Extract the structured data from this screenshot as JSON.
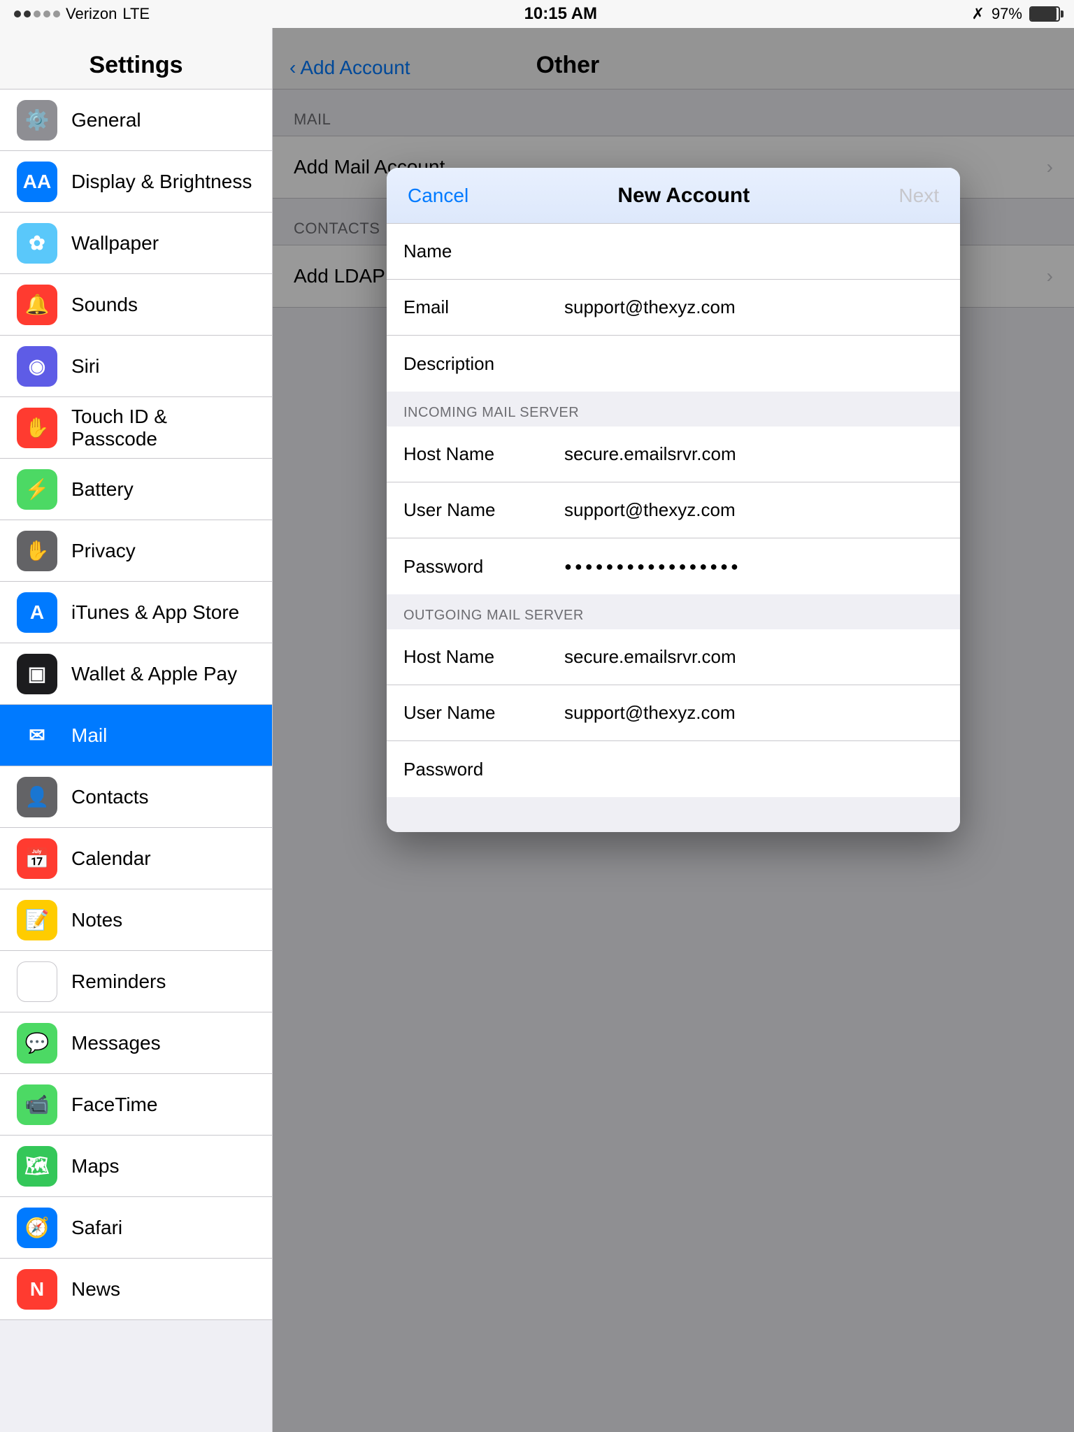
{
  "statusBar": {
    "carrier": "Verizon",
    "network": "LTE",
    "dots": [
      false,
      false,
      true,
      true,
      true
    ],
    "time": "10:15 AM",
    "bluetooth": "bluetooth",
    "battery_pct": "97%"
  },
  "sidebar": {
    "title": "Settings",
    "items": [
      {
        "id": "general",
        "label": "General",
        "icon": "⚙️",
        "iconClass": "icon-general",
        "active": false
      },
      {
        "id": "display",
        "label": "Display & Brightness",
        "icon": "AA",
        "iconClass": "icon-display",
        "active": false
      },
      {
        "id": "wallpaper",
        "label": "Wallpaper",
        "icon": "✿",
        "iconClass": "icon-wallpaper",
        "active": false
      },
      {
        "id": "sounds",
        "label": "Sounds",
        "icon": "🔔",
        "iconClass": "icon-sounds",
        "active": false
      },
      {
        "id": "siri",
        "label": "Siri",
        "icon": "◉",
        "iconClass": "icon-siri",
        "active": false
      },
      {
        "id": "touch",
        "label": "Touch ID & Passcode",
        "icon": "✋",
        "iconClass": "icon-touch",
        "active": false
      },
      {
        "id": "battery",
        "label": "Battery",
        "icon": "⚡",
        "iconClass": "icon-battery",
        "active": false
      },
      {
        "id": "privacy",
        "label": "Privacy",
        "icon": "✋",
        "iconClass": "icon-privacy",
        "active": false
      },
      {
        "id": "itunes",
        "label": "iTunes & App Store",
        "icon": "A",
        "iconClass": "icon-itunes",
        "active": false
      },
      {
        "id": "wallet",
        "label": "Wallet & Apple Pay",
        "icon": "▣",
        "iconClass": "icon-wallet",
        "active": false
      },
      {
        "id": "mail",
        "label": "Mail",
        "icon": "✉",
        "iconClass": "icon-mail",
        "active": true
      },
      {
        "id": "contacts",
        "label": "Contacts",
        "icon": "👤",
        "iconClass": "icon-contacts",
        "active": false
      },
      {
        "id": "calendar",
        "label": "Calendar",
        "icon": "📅",
        "iconClass": "icon-calendar",
        "active": false
      },
      {
        "id": "notes",
        "label": "Notes",
        "icon": "📝",
        "iconClass": "icon-notes",
        "active": false
      },
      {
        "id": "reminders",
        "label": "Reminders",
        "icon": "☰",
        "iconClass": "icon-reminders",
        "active": false
      },
      {
        "id": "messages",
        "label": "Messages",
        "icon": "💬",
        "iconClass": "icon-messages",
        "active": false
      },
      {
        "id": "facetime",
        "label": "FaceTime",
        "icon": "📹",
        "iconClass": "icon-facetime",
        "active": false
      },
      {
        "id": "maps",
        "label": "Maps",
        "icon": "🗺",
        "iconClass": "icon-maps",
        "active": false
      },
      {
        "id": "safari",
        "label": "Safari",
        "icon": "🧭",
        "iconClass": "icon-safari",
        "active": false
      },
      {
        "id": "news",
        "label": "News",
        "icon": "N",
        "iconClass": "icon-news",
        "active": false
      }
    ]
  },
  "rightPanel": {
    "backLabel": "Add Account",
    "title": "Other",
    "sections": [
      {
        "header": "MAIL",
        "items": [
          {
            "label": "Add Mail Account",
            "hasChevron": true
          }
        ]
      },
      {
        "header": "CONTACTS",
        "items": [
          {
            "label": "Add LDAP Account",
            "hasChevron": true
          }
        ]
      }
    ]
  },
  "modal": {
    "cancelLabel": "Cancel",
    "title": "New Account",
    "nextLabel": "Next",
    "fields": [
      {
        "label": "Name",
        "value": "",
        "placeholder": true,
        "type": "text"
      },
      {
        "label": "Email",
        "value": "support@thexyz.com",
        "placeholder": false,
        "type": "text"
      },
      {
        "label": "Description",
        "value": "",
        "placeholder": true,
        "type": "text"
      }
    ],
    "incomingSection": {
      "header": "INCOMING MAIL SERVER",
      "fields": [
        {
          "label": "Host Name",
          "value": "secure.emailsrvr.com",
          "placeholder": false,
          "type": "text"
        },
        {
          "label": "User Name",
          "value": "support@thexyz.com",
          "placeholder": false,
          "type": "text"
        },
        {
          "label": "Password",
          "value": "●●●●●●●●●●●●●●●●●",
          "placeholder": false,
          "type": "password"
        }
      ]
    },
    "outgoingSection": {
      "header": "OUTGOING MAIL SERVER",
      "fields": [
        {
          "label": "Host Name",
          "value": "secure.emailsrvr.com",
          "placeholder": false,
          "type": "text"
        },
        {
          "label": "User Name",
          "value": "support@thexyz.com",
          "placeholder": false,
          "type": "text"
        },
        {
          "label": "Password",
          "value": "",
          "placeholder": true,
          "type": "password"
        }
      ]
    }
  }
}
